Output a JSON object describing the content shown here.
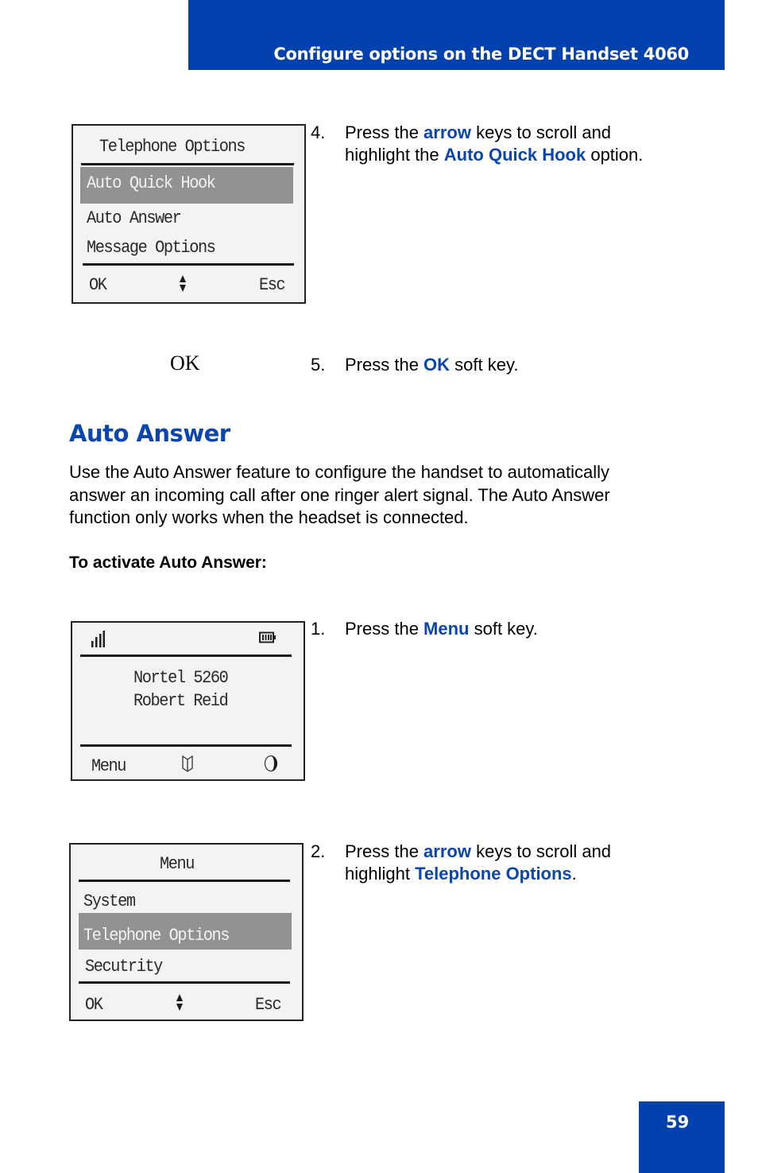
{
  "header": {
    "title": "Configure options on the DECT Handset 4060"
  },
  "screen1": {
    "title": "Telephone Options",
    "items": [
      "Auto Quick Hook",
      "Auto Answer",
      "Message Options"
    ],
    "highlighted": "Auto Quick Hook",
    "softkeys": {
      "left": "OK",
      "center_icon": "up-down-arrow-icon",
      "right": "Esc"
    }
  },
  "step4": {
    "number": "4.",
    "line1": [
      "Press the ",
      "arrow",
      " keys to scroll and"
    ],
    "line2": [
      "highlight the ",
      "Auto Quick Hook",
      " option."
    ]
  },
  "ok_graphic": "OK",
  "step5": {
    "number": "5.",
    "parts": [
      "Press the ",
      "OK",
      " soft key."
    ]
  },
  "section": {
    "title": "Auto Answer",
    "paragraph_lines": [
      "Use the Auto Answer feature to configure the handset to automatically",
      "answer an incoming call after one ringer alert signal. The Auto Answer",
      "function only works when the headset is connected."
    ],
    "procedure_heading": "To activate Auto Answer:"
  },
  "screen2": {
    "status_icons": [
      "signal-strength-icon",
      "battery-full-icon"
    ],
    "lines": [
      "Nortel 5260",
      "Robert Reid"
    ],
    "softkeys": {
      "left": "Menu",
      "center_icon": "directory-book-icon",
      "right_icon": "contrast-icon"
    }
  },
  "step1": {
    "number": "1.",
    "parts": [
      "Press the ",
      "Menu",
      " soft key."
    ]
  },
  "screen3": {
    "title": "Menu",
    "items": [
      "System",
      "Telephone Options",
      "Secutrity"
    ],
    "highlighted": "Telephone Options",
    "softkeys": {
      "left": "OK",
      "center_icon": "up-down-arrow-icon",
      "right": "Esc"
    }
  },
  "step2": {
    "number": "2.",
    "line1": [
      "Press the ",
      "arrow",
      " keys to scroll and"
    ],
    "line2": [
      "highlight ",
      "Telephone Options",
      "."
    ]
  },
  "footer": {
    "page_number": "59"
  },
  "colors": {
    "brand_blue": "#0341ae",
    "highlight_gray": "#929292",
    "lcd_bg": "#f2f3f2"
  }
}
